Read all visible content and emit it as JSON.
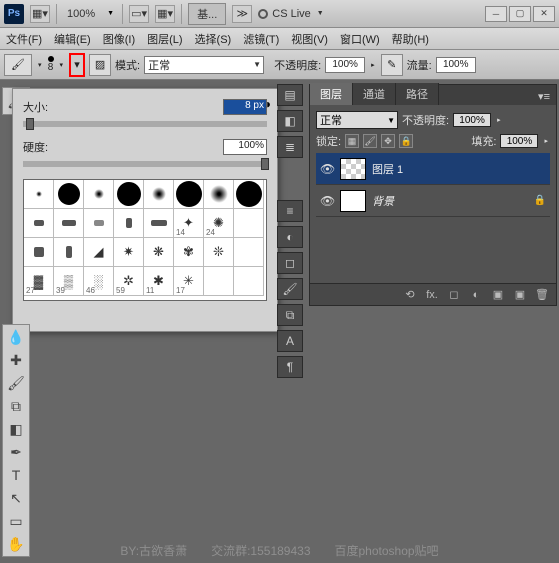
{
  "title": {
    "zoom": "100%",
    "doc": "基...",
    "cslive": "CS Live"
  },
  "menu": {
    "file": "文件(F)",
    "edit": "编辑(E)",
    "image": "图像(I)",
    "layer": "图层(L)",
    "select": "选择(S)",
    "filter": "滤镜(T)",
    "view": "视图(V)",
    "window": "窗口(W)",
    "help": "帮助(H)"
  },
  "opt": {
    "brush_size": "8",
    "mode_lbl": "模式:",
    "mode_val": "正常",
    "opacity_lbl": "不透明度:",
    "opacity_val": "100%",
    "flow_lbl": "流量:",
    "flow_val": "100%"
  },
  "brush": {
    "size_lbl": "大小:",
    "size_val": "8 px",
    "hard_lbl": "硬度:",
    "hard_val": "100%",
    "grid_nums": [
      [
        "27",
        "39",
        "46",
        "59",
        "11",
        "17"
      ]
    ]
  },
  "layers": {
    "tab_layers": "图层",
    "tab_channels": "通道",
    "tab_paths": "路径",
    "blend": "正常",
    "opacity_lbl": "不透明度:",
    "opacity_val": "100%",
    "lock_lbl": "锁定:",
    "fill_lbl": "填充:",
    "fill_val": "100%",
    "layer1": "图层 1",
    "bg": "背景"
  },
  "footer": {
    "fx": "fx."
  },
  "wm": "BY:古欲香萧　　交流群:155189433　　百度photoshop贴吧"
}
